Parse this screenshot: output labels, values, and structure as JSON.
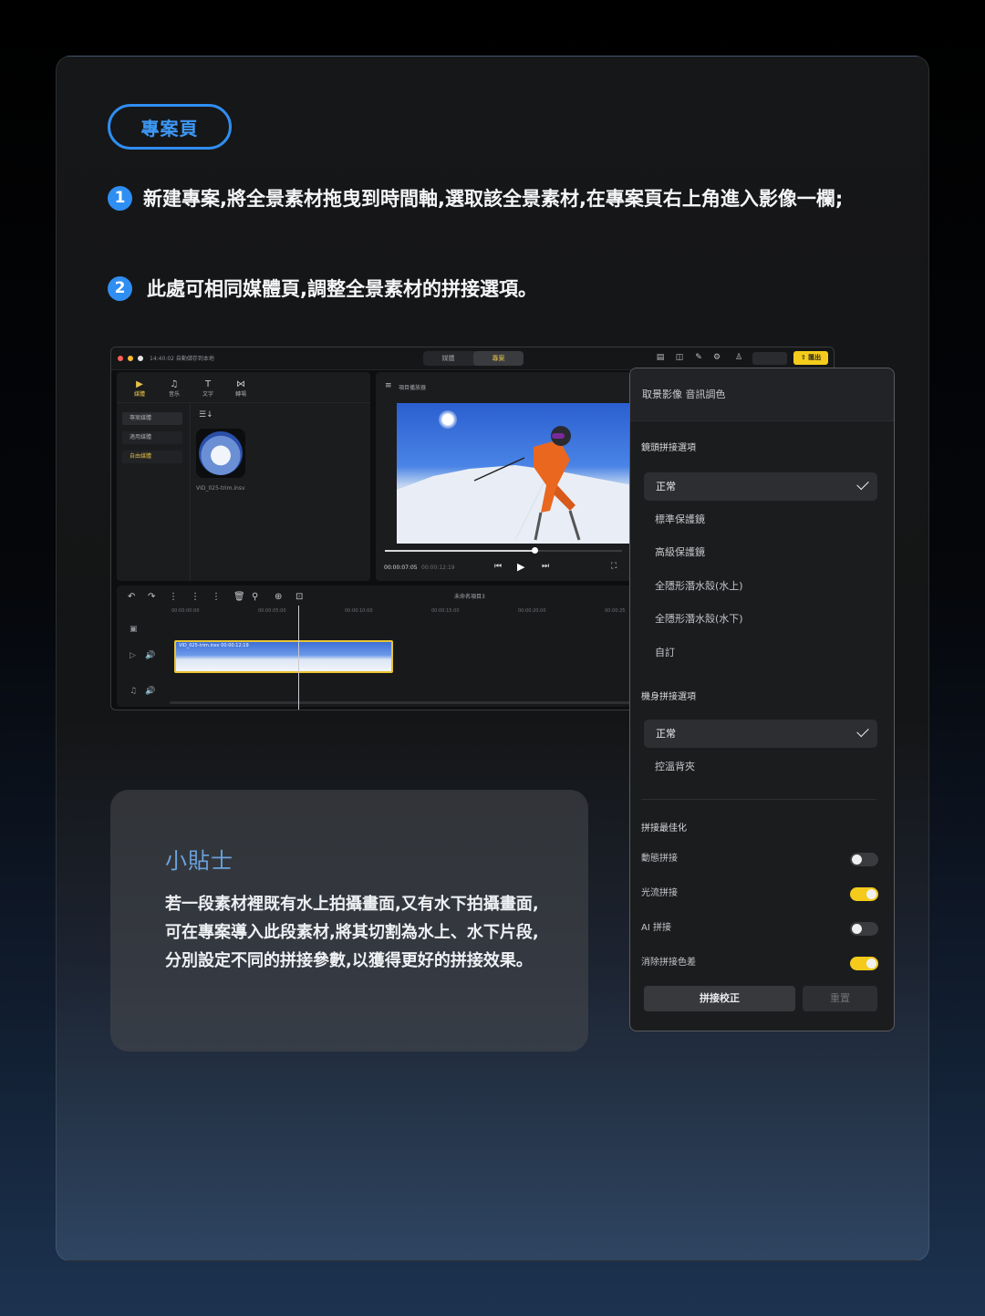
{
  "badge": "專案頁",
  "steps": [
    {
      "num": "1",
      "text": "新建專案,將全景素材拖曳到時間軸,選取該全景素材,在專案頁右上角進入影像一欄;"
    },
    {
      "num": "2",
      "text": "此處可相同媒體頁,調整全景素材的拼接選項。"
    }
  ],
  "editor": {
    "window_title": "14:40:02 自動儲存到本地",
    "top_tabs": [
      "媒體",
      "專案"
    ],
    "active_top_tab": "專案",
    "export_label": "⇧ 匯出",
    "panel_tabs": [
      {
        "icon": "▶",
        "label": "媒體"
      },
      {
        "icon": "♫",
        "label": "音乐"
      },
      {
        "icon": "T",
        "label": "文字"
      },
      {
        "icon": "⋈",
        "label": "轉場"
      }
    ],
    "sidebar": [
      "專案媒體",
      "適用媒體",
      "自由媒體"
    ],
    "media_filename": "VID_025-trim.insv",
    "player_label": "項目播放器",
    "timecode_current": "00:00:07:05",
    "timecode_total": "00:00:12:19",
    "project_name": "未命名項目3",
    "ruler": [
      "00:00:00:00",
      "00:00:05:00",
      "00:00:10:00",
      "00:00:15:00",
      "00:00:20:00",
      "00:00:25"
    ],
    "clip_label": "VID_025-trim.insv  00:00:12:19",
    "playback_progress": 0.63
  },
  "settings": {
    "header": "取景影像 音訊調色",
    "lens_section": "鏡頭拼接選項",
    "lens_options": [
      "正常",
      "標準保護鏡",
      "高級保護鏡",
      "全隱形潛水殼(水上)",
      "全隱形潛水殼(水下)",
      "自訂"
    ],
    "lens_selected": "正常",
    "body_section": "機身拼接選項",
    "body_options": [
      "正常",
      "控溫背夾"
    ],
    "body_selected": "正常",
    "optimize_section": "拼接最佳化",
    "toggles": [
      {
        "label": "動態拼接",
        "on": false
      },
      {
        "label": "光流拼接",
        "on": true
      },
      {
        "label": "AI 拼接",
        "on": false
      },
      {
        "label": "消除拼接色差",
        "on": true
      }
    ],
    "primary_button": "拼接校正",
    "secondary_button": "重置",
    "accent_color": "#f4cb1a"
  },
  "tip": {
    "title": "小貼士",
    "body": "若一段素材裡既有水上拍攝畫面,又有水下拍攝畫面,可在專案導入此段素材,將其切割為水上、水下片段,分別設定不同的拼接參數,以獲得更好的拼接效果。"
  },
  "colors": {
    "brand_blue": "#2f8ef2",
    "tip_title": "#6aa2dc"
  }
}
